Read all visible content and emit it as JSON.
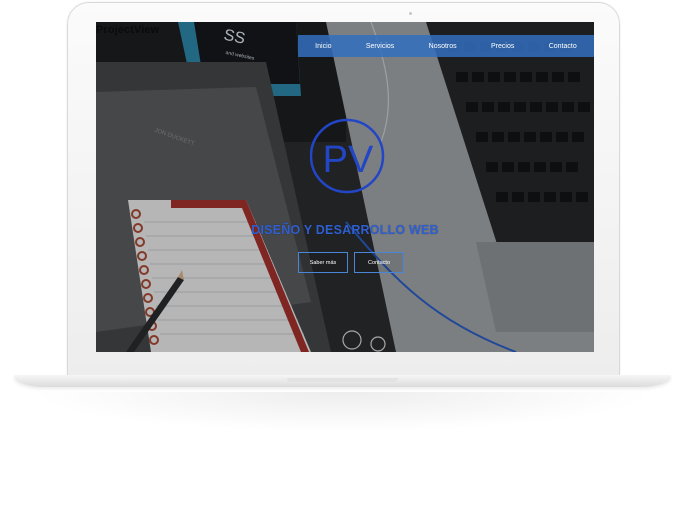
{
  "site": {
    "brand": "ProjectView",
    "nav": [
      "Inicio",
      "Servicios",
      "Nosotros",
      "Precios",
      "Contacto"
    ],
    "logo_text": "PV",
    "tagline": "DISEÑO Y DESARROLLO WEB",
    "buttons": {
      "primary": "Saber más",
      "secondary": "Contacto"
    }
  },
  "photo_text": {
    "book_cover": "SS",
    "book_subtitle": "and websites",
    "author": "JON DUCKETT"
  },
  "colors": {
    "nav_bar": "#326ebe",
    "accent": "#2f5fd0",
    "button_border": "#4a86d8",
    "laptop_body": "#f2f2f2"
  }
}
